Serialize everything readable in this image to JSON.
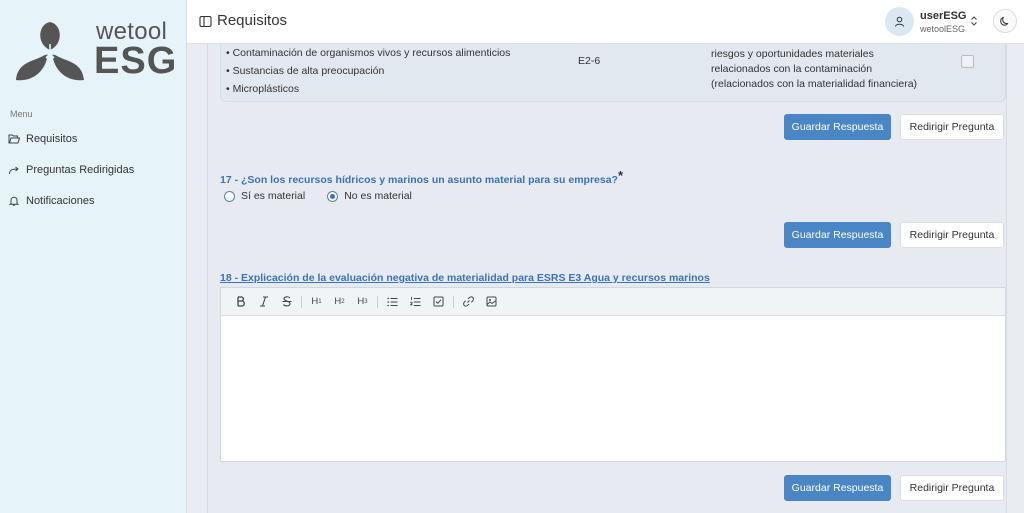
{
  "brand": {
    "word": "wetool",
    "esg": "ESG"
  },
  "sidebar": {
    "menu_label": "Menu",
    "items": [
      {
        "label": "Requisitos",
        "icon": "folder-open-icon"
      },
      {
        "label": "Preguntas Redirigidas",
        "icon": "redirect-arrow-icon"
      },
      {
        "label": "Notificaciones",
        "icon": "bell-icon"
      }
    ]
  },
  "header": {
    "title": "Requisitos",
    "user_name": "userESG",
    "user_org": "wetoolESG"
  },
  "table_row": {
    "bullets": [
      "• Contaminación de organismos vivos y recursos alimenticios",
      "• Sustancias de alta preocupación",
      "• Microplásticos"
    ],
    "code": "E2-6",
    "description": "riesgos y oportunidades materiales relacionados con la contaminación (relacionados con la materialidad financiera)"
  },
  "buttons": {
    "save": "Guardar Respuesta",
    "redirect": "Redirigir Pregunta"
  },
  "q17": {
    "text": "17 - ¿Son los recursos hídricos y marinos un asunto material para su empresa?",
    "required_mark": "*",
    "options": [
      "Sí es material",
      "No es material"
    ],
    "selected": "No es material"
  },
  "q18": {
    "text": "18 - Explicación de la evaluación negativa de materialidad para ESRS E3 Agua y recursos marinos",
    "toolbar": [
      "B",
      "I",
      "S",
      "H1",
      "H2",
      "H3",
      "bullet-list",
      "ordered-list",
      "task-list",
      "link",
      "image"
    ]
  },
  "colors": {
    "accent": "#4a86c5",
    "question": "#3a72b8",
    "sidebar_bg": "#e6f4fa"
  }
}
